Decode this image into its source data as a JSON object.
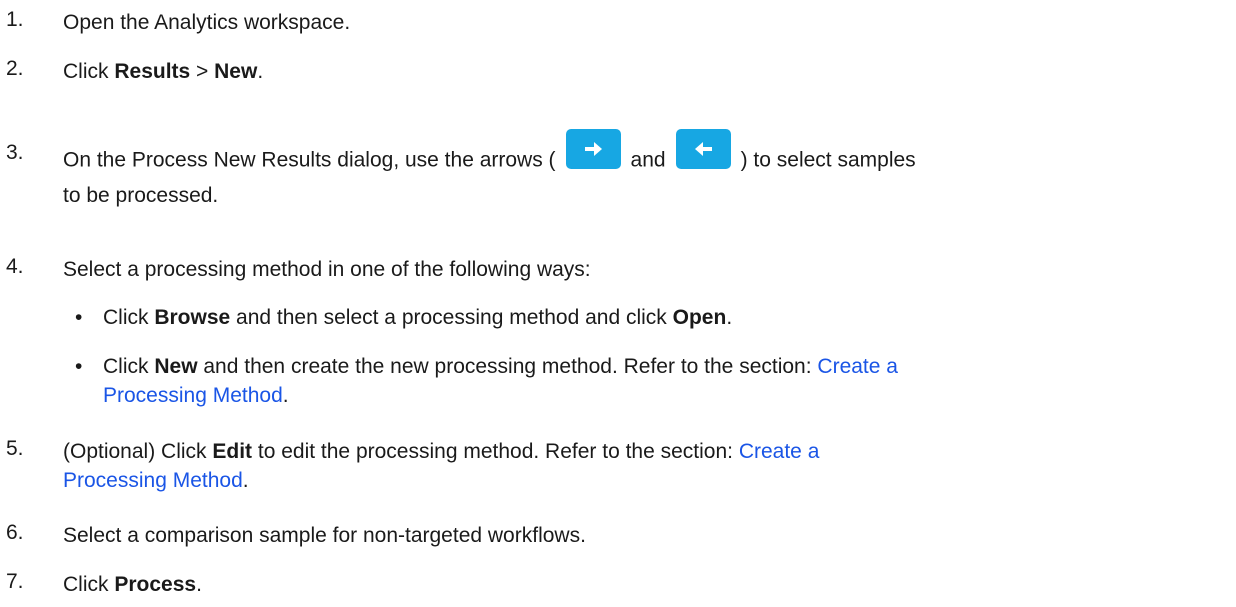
{
  "steps": [
    {
      "num": "1.",
      "text": "Open the Analytics workspace."
    },
    {
      "num": "2.",
      "pre": "Click ",
      "bold1": "Results",
      "mid": " > ",
      "bold2": "New",
      "post": "."
    },
    {
      "num": "3.",
      "pre": "On the Process New Results dialog, use the arrows (",
      "mid": "and",
      "post": ") to select samples",
      "line2": "to be processed."
    },
    {
      "num": "4.",
      "text": "Select a processing method in one of the following ways:"
    },
    {
      "num": "5.",
      "pre": "(Optional) Click ",
      "bold": "Edit",
      "post": " to edit the processing method. Refer to the section: ",
      "link1": "Create a",
      "link2": "Processing Method",
      "end": "."
    },
    {
      "num": "6.",
      "text": "Select a comparison sample for non-targeted workflows."
    },
    {
      "num": "7.",
      "pre": "Click ",
      "bold": "Process",
      "post": "."
    }
  ],
  "bullets": [
    {
      "dot": "•",
      "pre": "Click ",
      "bold1": "Browse",
      "mid": " and then select a processing method and click ",
      "bold2": "Open",
      "post": "."
    },
    {
      "dot": "•",
      "pre": "Click ",
      "bold": "New",
      "post": " and then create the new processing method. Refer to the section: ",
      "link1": "Create a",
      "link2": "Processing Method",
      "end": "."
    }
  ],
  "icons": {
    "right_arrow": "right-arrow-button-icon",
    "left_arrow": "left-arrow-button-icon"
  },
  "colors": {
    "link": "#1a55e6",
    "arrow_button": "#17a7e3"
  }
}
